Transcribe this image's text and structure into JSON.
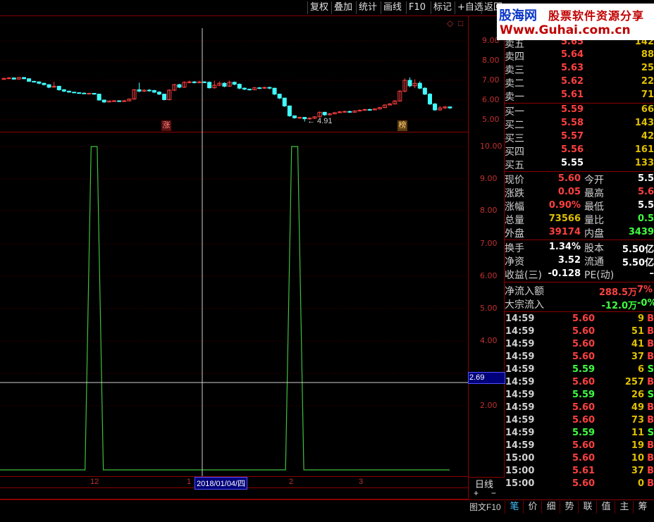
{
  "toolbar": {
    "items": [
      "复权",
      "叠加",
      "统计",
      "画线",
      "F10",
      "标记",
      "+自选",
      "返回"
    ]
  },
  "watermark": {
    "brand": "股海网",
    "slogan": "股票软件资源分享",
    "url": "Www.Guhai.com.cn"
  },
  "kline_panel": {
    "y_ticks": [
      "9.00",
      "8.00",
      "7.00",
      "6.00",
      "5.00"
    ],
    "low_marker": "← 4.91",
    "tag_zhang": "涨",
    "tag_bang": "榜",
    "top_icons": [
      "◇",
      "□"
    ]
  },
  "indicator_panel": {
    "y_ticks": [
      "10.00",
      "9.00",
      "8.00",
      "7.00",
      "6.00",
      "5.00",
      "4.00",
      "2.00"
    ],
    "crosshair_value": "2.69"
  },
  "x_axis": {
    "labels": [
      "12",
      "1",
      "2018/01/04/四",
      "2",
      "3"
    ],
    "period": "日线",
    "zoom_in": "+",
    "zoom_out": "−"
  },
  "order_book": {
    "asks": [
      {
        "name": "卖五",
        "price": "5.65",
        "vol": "142"
      },
      {
        "name": "卖四",
        "price": "5.64",
        "vol": "88"
      },
      {
        "name": "卖三",
        "price": "5.63",
        "vol": "25"
      },
      {
        "name": "卖二",
        "price": "5.62",
        "vol": "22"
      },
      {
        "name": "卖一",
        "price": "5.61",
        "vol": "71"
      }
    ],
    "bids": [
      {
        "name": "买一",
        "price": "5.59",
        "vol": "66"
      },
      {
        "name": "买二",
        "price": "5.58",
        "vol": "143"
      },
      {
        "name": "买三",
        "price": "5.57",
        "vol": "42"
      },
      {
        "name": "买四",
        "price": "5.56",
        "vol": "161"
      },
      {
        "name": "买五",
        "price": "5.55",
        "vol": "133"
      }
    ]
  },
  "stats": {
    "rows1": [
      {
        "l1": "现价",
        "v1": "5.60",
        "c1": "red",
        "l2": "今开",
        "v2": "5.5",
        "c2": "white"
      },
      {
        "l1": "涨跌",
        "v1": "0.05",
        "c1": "red",
        "l2": "最高",
        "v2": "5.6",
        "c2": "red"
      },
      {
        "l1": "涨幅",
        "v1": "0.90%",
        "c1": "red",
        "l2": "最低",
        "v2": "5.5",
        "c2": "white"
      },
      {
        "l1": "总量",
        "v1": "73566",
        "c1": "yellow",
        "l2": "量比",
        "v2": "0.5",
        "c2": "green"
      },
      {
        "l1": "外盘",
        "v1": "39174",
        "c1": "red",
        "l2": "内盘",
        "v2": "3439",
        "c2": "green"
      }
    ],
    "rows2": [
      {
        "l1": "换手",
        "v1": "1.34%",
        "c1": "white",
        "l2": "股本",
        "v2": "5.50亿",
        "c2": "white"
      },
      {
        "l1": "净资",
        "v1": "3.52",
        "c1": "white",
        "l2": "流通",
        "v2": "5.50亿",
        "c2": "white"
      },
      {
        "l1": "收益(三)",
        "v1": "-0.128",
        "c1": "white",
        "l2": "PE(动)",
        "v2": "–",
        "c2": "white"
      }
    ],
    "flows": [
      {
        "label": "净流入额",
        "v1": "288.5万",
        "v2": "7%",
        "c1": "red",
        "c2": "red"
      },
      {
        "label": "大宗流入",
        "v1": "-12.0万",
        "v2": "-0%",
        "c1": "green",
        "c2": "green"
      }
    ]
  },
  "ticks": [
    {
      "time": "14:59",
      "price": "5.60",
      "vol": "9",
      "dir": "B"
    },
    {
      "time": "14:59",
      "price": "5.60",
      "vol": "51",
      "dir": "B"
    },
    {
      "time": "14:59",
      "price": "5.60",
      "vol": "41",
      "dir": "B"
    },
    {
      "time": "14:59",
      "price": "5.60",
      "vol": "37",
      "dir": "B"
    },
    {
      "time": "14:59",
      "price": "5.59",
      "vol": "6",
      "dir": "S"
    },
    {
      "time": "14:59",
      "price": "5.60",
      "vol": "257",
      "dir": "B"
    },
    {
      "time": "14:59",
      "price": "5.59",
      "vol": "26",
      "dir": "S"
    },
    {
      "time": "14:59",
      "price": "5.60",
      "vol": "49",
      "dir": "B"
    },
    {
      "time": "14:59",
      "price": "5.60",
      "vol": "73",
      "dir": "B"
    },
    {
      "time": "14:59",
      "price": "5.59",
      "vol": "11",
      "dir": "S"
    },
    {
      "time": "14:59",
      "price": "5.60",
      "vol": "19",
      "dir": "B"
    },
    {
      "time": "15:00",
      "price": "5.60",
      "vol": "10",
      "dir": "B"
    },
    {
      "time": "15:00",
      "price": "5.61",
      "vol": "37",
      "dir": "B"
    },
    {
      "time": "15:00",
      "price": "5.60",
      "vol": "0",
      "dir": "B"
    }
  ],
  "bottom_tabs": {
    "left": "图文F10",
    "items": [
      "笔",
      "价",
      "细",
      "势",
      "联",
      "值",
      "主",
      "筹"
    ]
  },
  "colors": {
    "up": "#ff4040",
    "down": "#40ffff",
    "indicator_line": "#40c040",
    "frame": "#8b0000",
    "volume": "#e0c000"
  },
  "chart_data": {
    "type": "line",
    "series": [
      {
        "values": [
          0,
          0,
          0,
          0,
          0,
          0,
          0,
          0,
          0,
          0,
          0,
          0,
          0,
          0,
          0,
          10,
          10,
          0,
          0,
          0,
          0,
          0,
          0,
          0,
          0,
          0,
          0,
          0,
          0,
          0,
          0,
          0,
          0,
          0,
          0,
          0,
          0,
          0,
          0,
          0,
          0,
          0,
          0,
          0,
          0,
          0,
          0,
          0,
          10,
          10,
          0,
          0,
          0,
          0,
          0,
          0,
          0,
          0,
          0,
          0,
          0,
          0,
          0,
          0,
          0,
          0,
          0,
          0,
          0,
          0,
          0,
          0,
          0,
          0,
          0
        ]
      }
    ],
    "ylim": [
      0,
      10.5
    ]
  },
  "kline_data": {
    "type": "candlestick",
    "ylim": [
      4.6,
      9.3
    ],
    "candles": [
      [
        7.05,
        7.1,
        7.02,
        7.12
      ],
      [
        7.1,
        7.12,
        7.06,
        7.16
      ],
      [
        7.12,
        7.06,
        7.03,
        7.15
      ],
      [
        7.06,
        7.14,
        7.04,
        7.18
      ],
      [
        7.14,
        7.08,
        7.05,
        7.17
      ],
      [
        7.08,
        6.95,
        6.92,
        7.1
      ],
      [
        6.95,
        6.92,
        6.88,
        6.97
      ],
      [
        6.92,
        6.85,
        6.8,
        6.95
      ],
      [
        6.85,
        6.78,
        6.74,
        6.88
      ],
      [
        6.78,
        6.65,
        6.6,
        6.8
      ],
      [
        6.65,
        6.7,
        6.62,
        6.92
      ],
      [
        6.7,
        6.52,
        6.48,
        6.72
      ],
      [
        6.52,
        6.45,
        6.4,
        6.56
      ],
      [
        6.45,
        6.4,
        6.38,
        6.48
      ],
      [
        6.4,
        6.37,
        6.34,
        6.42
      ],
      [
        6.37,
        6.35,
        6.32,
        6.4
      ],
      [
        6.35,
        6.33,
        6.3,
        6.38
      ],
      [
        6.33,
        6.34,
        6.3,
        6.37
      ],
      [
        6.34,
        6.3,
        6.27,
        6.36
      ],
      [
        6.3,
        6.0,
        5.97,
        6.32
      ],
      [
        6.0,
        5.9,
        5.85,
        6.02
      ],
      [
        5.9,
        5.95,
        5.88,
        5.98
      ],
      [
        5.95,
        5.96,
        5.92,
        6.0
      ],
      [
        5.96,
        5.94,
        5.9,
        5.98
      ],
      [
        5.94,
        5.96,
        5.92,
        6.0
      ],
      [
        5.96,
        6.05,
        5.94,
        6.08
      ],
      [
        6.05,
        6.52,
        6.02,
        6.55
      ],
      [
        6.52,
        6.45,
        6.4,
        6.88
      ],
      [
        6.45,
        6.5,
        6.4,
        6.55
      ],
      [
        6.5,
        6.48,
        6.42,
        6.56
      ],
      [
        6.48,
        6.4,
        6.35,
        6.52
      ],
      [
        6.4,
        6.3,
        6.25,
        6.45
      ],
      [
        6.3,
        6.02,
        5.98,
        6.32
      ],
      [
        6.02,
        6.5,
        5.98,
        6.55
      ],
      [
        6.5,
        6.78,
        6.45,
        6.82
      ],
      [
        6.78,
        6.65,
        6.6,
        6.82
      ],
      [
        6.65,
        6.9,
        6.62,
        6.95
      ],
      [
        6.9,
        6.92,
        6.85,
        6.98
      ],
      [
        6.92,
        6.88,
        6.84,
        6.96
      ],
      [
        6.88,
        6.92,
        6.85,
        6.98
      ],
      [
        6.92,
        6.9,
        6.86,
        6.95
      ],
      [
        6.9,
        6.62,
        6.58,
        6.94
      ],
      [
        6.62,
        6.75,
        6.58,
        6.98
      ],
      [
        6.75,
        6.85,
        6.7,
        6.95
      ],
      [
        6.85,
        6.7,
        6.65,
        6.9
      ],
      [
        6.7,
        6.9,
        6.68,
        6.98
      ],
      [
        6.9,
        6.8,
        6.75,
        6.94
      ],
      [
        6.8,
        6.6,
        6.55,
        6.84
      ],
      [
        6.6,
        6.55,
        6.5,
        6.64
      ],
      [
        6.55,
        6.52,
        6.48,
        6.58
      ],
      [
        6.52,
        6.62,
        6.5,
        6.66
      ],
      [
        6.62,
        6.6,
        6.56,
        6.66
      ],
      [
        6.6,
        6.64,
        6.56,
        6.68
      ],
      [
        6.64,
        6.6,
        6.55,
        6.68
      ],
      [
        6.6,
        6.3,
        6.25,
        6.62
      ],
      [
        6.3,
        6.1,
        6.05,
        6.32
      ],
      [
        6.1,
        5.7,
        5.65,
        6.12
      ],
      [
        5.7,
        5.2,
        5.15,
        5.72
      ],
      [
        5.2,
        5.1,
        5.05,
        5.22
      ],
      [
        5.1,
        5.12,
        5.04,
        5.16
      ],
      [
        5.12,
        5.05,
        4.91,
        5.14
      ],
      [
        5.05,
        5.08,
        5.0,
        5.12
      ],
      [
        5.08,
        5.15,
        5.04,
        5.18
      ],
      [
        5.15,
        5.38,
        5.12,
        5.42
      ],
      [
        5.38,
        5.25,
        5.2,
        5.4
      ],
      [
        5.25,
        5.3,
        5.22,
        5.34
      ],
      [
        5.3,
        5.36,
        5.28,
        5.4
      ],
      [
        5.36,
        5.4,
        5.34,
        5.44
      ],
      [
        5.4,
        5.42,
        5.36,
        5.46
      ],
      [
        5.42,
        5.38,
        5.35,
        5.46
      ],
      [
        5.38,
        5.45,
        5.36,
        5.48
      ],
      [
        5.45,
        5.48,
        5.42,
        5.52
      ],
      [
        5.48,
        5.52,
        5.45,
        5.56
      ],
      [
        5.52,
        5.5,
        5.46,
        5.56
      ],
      [
        5.5,
        5.55,
        5.48,
        5.58
      ],
      [
        5.55,
        5.62,
        5.52,
        5.66
      ],
      [
        5.62,
        5.75,
        5.58,
        5.78
      ],
      [
        5.75,
        5.8,
        5.72,
        5.85
      ],
      [
        5.8,
        5.95,
        5.78,
        6.0
      ],
      [
        5.95,
        6.45,
        5.92,
        6.5
      ],
      [
        6.45,
        7.0,
        6.4,
        7.1
      ],
      [
        7.0,
        6.72,
        6.65,
        7.15
      ],
      [
        6.72,
        6.85,
        6.6,
        7.05
      ],
      [
        6.85,
        6.6,
        6.55,
        6.95
      ],
      [
        6.6,
        6.3,
        6.25,
        6.65
      ],
      [
        6.3,
        5.8,
        5.75,
        6.35
      ],
      [
        5.8,
        5.5,
        5.45,
        5.85
      ],
      [
        5.5,
        5.6,
        5.45,
        5.7
      ],
      [
        5.6,
        5.65,
        5.55,
        5.7
      ],
      [
        5.65,
        5.6,
        5.55,
        5.68
      ]
    ]
  }
}
